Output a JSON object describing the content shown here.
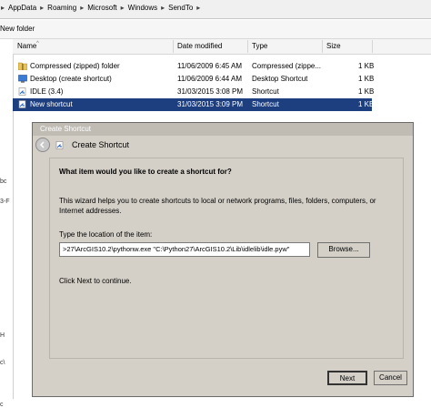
{
  "address_bar": {
    "crumbs": [
      "AppData",
      "Roaming",
      "Microsoft",
      "Windows",
      "SendTo"
    ],
    "separator": "▸"
  },
  "toolbar": {
    "new_folder": "New folder"
  },
  "left_pane": {
    "fragments": [
      "bc",
      "3-F",
      "H",
      "c\\",
      "c"
    ]
  },
  "columns": {
    "name": "Name",
    "date": "Date modified",
    "type": "Type",
    "size": "Size",
    "sort_arrow": "^"
  },
  "files": [
    {
      "name": "Compressed (zipped) folder",
      "date": "11/06/2009 6:45 AM",
      "type": "Compressed (zippe...",
      "size": "1 KB",
      "icon": "zip-folder-icon"
    },
    {
      "name": "Desktop (create shortcut)",
      "date": "11/06/2009 6:44 AM",
      "type": "Desktop Shortcut",
      "size": "1 KB",
      "icon": "desktop-icon"
    },
    {
      "name": "IDLE (3.4)",
      "date": "31/03/2015 3:08 PM",
      "type": "Shortcut",
      "size": "1 KB",
      "icon": "shortcut-file-icon"
    },
    {
      "name": "New shortcut",
      "date": "31/03/2015 3:09 PM",
      "type": "Shortcut",
      "size": "1 KB",
      "icon": "shortcut-file-icon",
      "selected": true
    }
  ],
  "dialog": {
    "window_title": "Create Shortcut",
    "header": "Create Shortcut",
    "question": "What item would you like to create a shortcut for?",
    "description": "This wizard helps you to create shortcuts to local or network programs, files, folders, computers, or Internet addresses.",
    "location_label": "Type the location of the item:",
    "location_value": ">27\\ArcGIS10.2\\pythonw.exe \"C:\\Python27\\ArcGIS10.2\\Lib\\idlelib\\idle.pyw\"",
    "browse": "Browse...",
    "continue_text": "Click Next to continue.",
    "next": "Next",
    "cancel": "Cancel"
  },
  "colors": {
    "selection": "#1d3f80",
    "dialog_bg": "#d4d0c8"
  }
}
